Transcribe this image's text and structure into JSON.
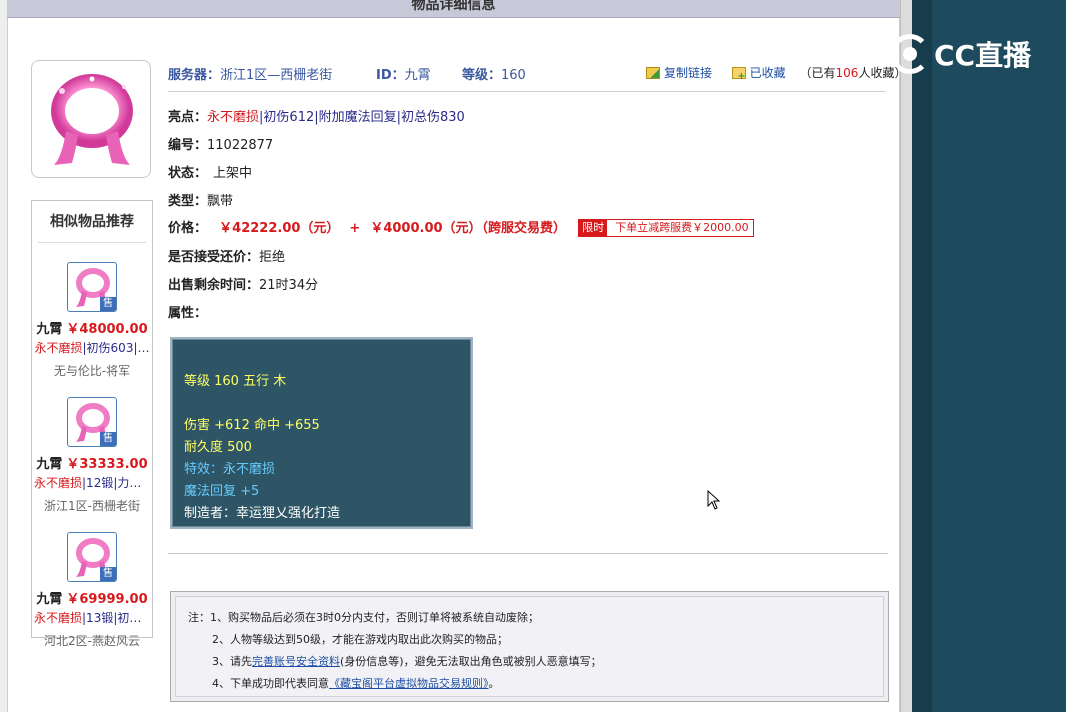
{
  "page": {
    "title": "物品详细信息"
  },
  "brand": {
    "logo_text": "CC直播",
    "colors": {
      "panel_dark": "#1d4a5c",
      "accent_red": "#d7191c",
      "link_blue": "#1d4ea3"
    }
  },
  "header": {
    "server_label": "服务器：",
    "server_value": "浙江1区—西栅老街",
    "id_label": "ID：",
    "id_value": "九霄",
    "level_label": "等级：",
    "level_value": "160",
    "copy_link_label": "复制链接",
    "favorited_label": "已收藏",
    "fav_count_prefix": "（已有",
    "fav_count": "106",
    "fav_count_suffix": "人收藏）"
  },
  "item": {
    "highlight_label": "亮点：",
    "highlight_red": "永不磨损",
    "highlight_sep": "|",
    "highlight_rest": "初伤612|附加魔法回复|初总伤830",
    "number_label": "编号：",
    "number_value": "11022877",
    "status_label": "状态：",
    "status_value": "上架中",
    "type_label": "类型：",
    "type_value": "飘带",
    "price_label": "价格：",
    "price_value": "￥42222.00（元）",
    "price_plus": "+",
    "fee_value": "￥4000.00（元）（跨服交易费）",
    "promo_tag": "限时",
    "promo_text": "下单立减跨服费￥2000.00",
    "counter_label": "是否接受还价：",
    "counter_value": "拒绝",
    "remaining_label": "出售剩余时间：",
    "remaining_value": "21时34分",
    "attr_label": "属性："
  },
  "attributes": {
    "line1": "等级 160 五行 木",
    "line2": "伤害 +612 命中 +655",
    "line3": "耐久度 500",
    "line4": "特效：永不磨损",
    "line5": "魔法回复 +5",
    "line6": "制造者：幸运狸乂强化打造"
  },
  "similar": {
    "title": "相似物品推荐",
    "sell_badge": "售",
    "items": [
      {
        "name": "九霄",
        "price": "￥48000.00",
        "tag_red": "永不磨损",
        "tag_rest": "|初伤603|…",
        "server": "无与伦比-将军"
      },
      {
        "name": "九霄",
        "price": "￥33333.00",
        "tag_red": "永不磨损",
        "tag_rest": "|12锻|力敏…",
        "server": "浙江1区-西栅老街"
      },
      {
        "name": "九霄",
        "price": "￥69999.00",
        "tag_red": "永不磨损",
        "tag_rest": "|13锻|初伤…",
        "server": "河北2区-燕赵风云"
      }
    ]
  },
  "notes": {
    "n1": "注：1、购买物品后必须在3时0分内支付，否则订单将被系统自动废除；",
    "n2": "2、人物等级达到50级，才能在游戏内取出此次购买的物品；",
    "n3_pre": "3、请先",
    "n3_link": "完善账号安全资料",
    "n3_post": "(身份信息等)，避免无法取出角色或被别人恶意填写；",
    "n4_pre": "4、下单成功即代表同意",
    "n4_link": "《藏宝阁平台虚拟物品交易规则》",
    "n4_post": "。"
  }
}
